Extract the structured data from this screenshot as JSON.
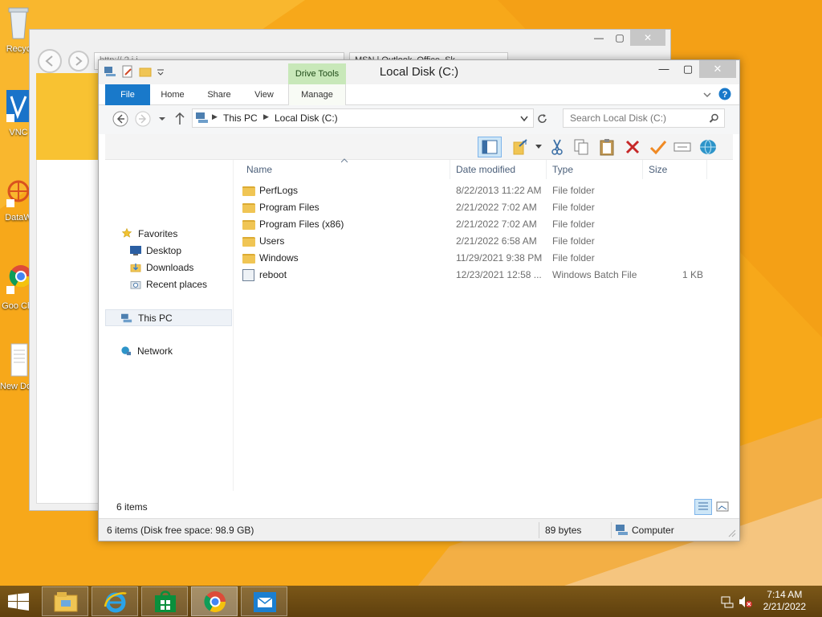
{
  "desktop": {
    "icons": [
      {
        "label": "Recycle Bin",
        "visible": "Recyc",
        "icon": "recycle-bin-icon"
      },
      {
        "label": "VNC",
        "visible": "VNC",
        "icon": "vnc-icon"
      },
      {
        "label": "DataW",
        "visible": "DataW",
        "icon": "data-icon"
      },
      {
        "label": "Google Chrome",
        "visible": "Goo Chr",
        "icon": "chrome-icon"
      },
      {
        "label": "New Document",
        "visible": "New Docu",
        "icon": "text-document-icon"
      }
    ]
  },
  "background_window": {
    "address": "http://                 ?     i   i",
    "tab_title": "MSN | Outlook, Office, Sk"
  },
  "explorer": {
    "title": "Local Disk (C:)",
    "context_tab_group": "Drive Tools",
    "tabs": [
      "File",
      "Home",
      "Share",
      "View",
      "Manage"
    ],
    "breadcrumb": [
      "This PC",
      "Local Disk (C:)"
    ],
    "search_placeholder": "Search Local Disk (C:)",
    "nav": {
      "favorites": "Favorites",
      "desktop": "Desktop",
      "downloads": "Downloads",
      "recent": "Recent places",
      "this_pc": "This PC",
      "network": "Network"
    },
    "columns": [
      "Name",
      "Date modified",
      "Type",
      "Size"
    ],
    "files": [
      {
        "name": "PerfLogs",
        "date": "8/22/2013 11:22 AM",
        "type": "File folder",
        "size": "",
        "kind": "folder"
      },
      {
        "name": "Program Files",
        "date": "2/21/2022 7:02 AM",
        "type": "File folder",
        "size": "",
        "kind": "folder"
      },
      {
        "name": "Program Files (x86)",
        "date": "2/21/2022 7:02 AM",
        "type": "File folder",
        "size": "",
        "kind": "folder"
      },
      {
        "name": "Users",
        "date": "2/21/2022 6:58 AM",
        "type": "File folder",
        "size": "",
        "kind": "folder"
      },
      {
        "name": "Windows",
        "date": "11/29/2021 9:38 PM",
        "type": "File folder",
        "size": "",
        "kind": "folder"
      },
      {
        "name": "reboot",
        "date": "12/23/2021 12:58 ...",
        "type": "Windows Batch File",
        "size": "1 KB",
        "kind": "batch"
      }
    ],
    "item_count": "6 items",
    "status_left": "6 items (Disk free space: 98.9 GB)",
    "status_size": "89 bytes",
    "status_location": "Computer"
  },
  "taskbar": {
    "apps": [
      "File Explorer",
      "Internet Explorer",
      "Store",
      "Google Chrome",
      "Mail"
    ],
    "time": "7:14 AM",
    "date": "2/21/2022"
  },
  "colors": {
    "accent": "#1979ca",
    "drive_tools": "#c8e8b9",
    "wallpaper": "#f6a61b"
  }
}
